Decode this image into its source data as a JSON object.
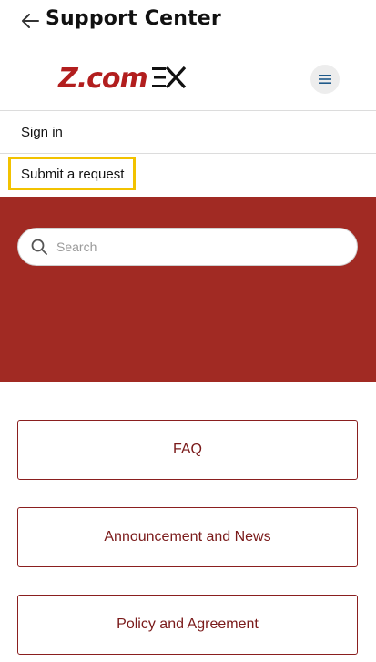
{
  "header": {
    "title": "Support Center",
    "back_icon": "arrow-left-icon"
  },
  "brand": {
    "logo_text": "Z.com",
    "logo_suffix": "EX",
    "brand_color": "#b21e1e",
    "menu_icon": "hamburger-menu-icon"
  },
  "nav": {
    "sign_in": "Sign in",
    "submit_request": "Submit a request",
    "highlight_color": "#f2c200"
  },
  "hero": {
    "background_color": "#a12a23",
    "search_placeholder": "Search",
    "search_icon": "search-icon"
  },
  "categories": [
    {
      "label": "FAQ"
    },
    {
      "label": "Announcement and News"
    },
    {
      "label": "Policy and Agreement"
    }
  ]
}
